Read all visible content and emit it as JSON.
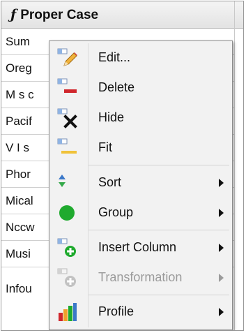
{
  "column": {
    "function_symbol": "ƒ",
    "title": "Proper Case",
    "rows": [
      "Sum",
      "Oreg",
      "M s c",
      "Pacif",
      "V I s",
      "Phor",
      "Mical",
      "Nccw",
      "Musi",
      "Infou"
    ]
  },
  "menu": {
    "items": [
      {
        "label": "Edit...",
        "icon": "pencil-edit-icon"
      },
      {
        "label": "Delete",
        "icon": "delete-minus-icon"
      },
      {
        "label": "Hide",
        "icon": "hide-x-icon"
      },
      {
        "label": "Fit",
        "icon": "fit-column-icon"
      },
      {
        "label": "Sort",
        "icon": "sort-arrows-icon",
        "submenu": true
      },
      {
        "label": "Group",
        "icon": "green-dot-icon",
        "submenu": true
      },
      {
        "label": "Insert Column",
        "icon": "insert-column-plus-icon",
        "submenu": true
      },
      {
        "label": "Transformation",
        "icon": "transformation-icon",
        "submenu": true,
        "disabled": true
      },
      {
        "label": "Profile",
        "icon": "bar-chart-icon",
        "submenu": true
      }
    ]
  },
  "colors": {
    "accent_blue": "#3b78c9",
    "delete_red": "#d0262c",
    "green": "#1faa2e",
    "yellow": "#f0c23a",
    "disabled_text": "#9b9b9b"
  }
}
